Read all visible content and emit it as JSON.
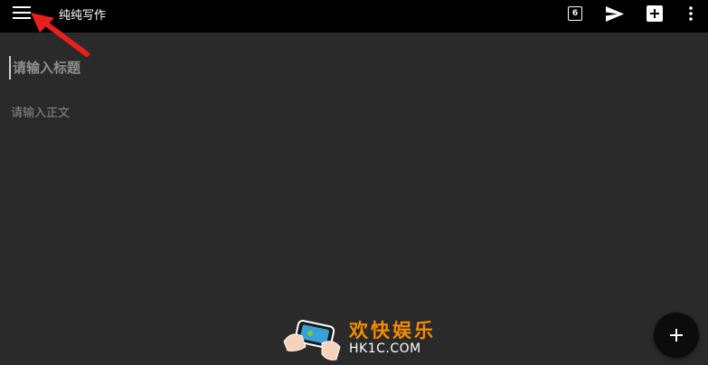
{
  "app": {
    "title": "纯纯写作"
  },
  "toolbar": {
    "menu_icon": "hamburger-menu-icon",
    "count_badge": "6",
    "send_icon": "send-icon",
    "add_icon": "add-box-icon",
    "more_icon": "more-vertical-icon"
  },
  "editor": {
    "title_placeholder": "请输入标题",
    "body_placeholder": "请输入正文"
  },
  "fab": {
    "icon": "plus-icon"
  },
  "watermark": {
    "text_cn": "欢快娱乐",
    "text_en": "HK1C.COM"
  },
  "colors": {
    "toolbar_bg": "#000000",
    "editor_bg": "#2a2a2a",
    "annotation_arrow": "#e8201c",
    "watermark_accent": "#f28c00"
  }
}
